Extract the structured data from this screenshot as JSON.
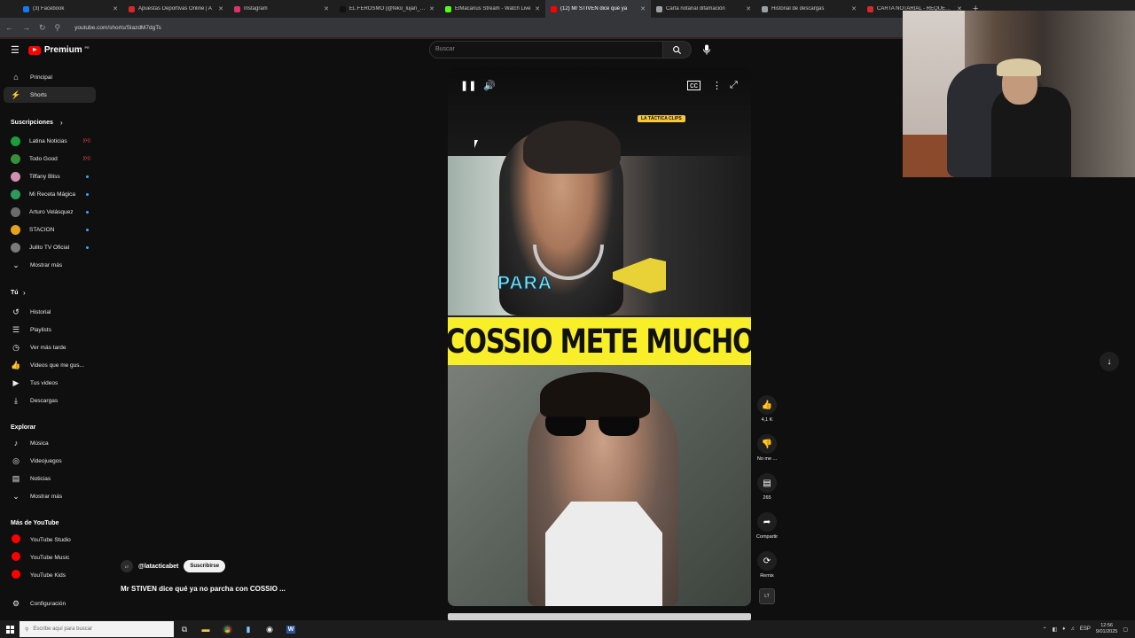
{
  "browser": {
    "tabs": [
      {
        "label": "(3) Facebook",
        "color": "#1877f2",
        "active": false
      },
      {
        "label": "Apuestas Deportivas Online | A",
        "color": "#d62828",
        "active": false
      },
      {
        "label": "Instagram",
        "color": "#e1306c",
        "active": false
      },
      {
        "label": "EL FEROSMO (@feko_lujan_cari",
        "color": "#111111",
        "active": false
      },
      {
        "label": "ElMacarius Stream - Watch Live",
        "color": "#53fc18",
        "active": false
      },
      {
        "label": "(12) Mr STIVEN dice qué ya",
        "color": "#ff0000",
        "active": true
      },
      {
        "label": "Carta notarial difamación",
        "color": "#9aa0a6",
        "active": false
      },
      {
        "label": "Historial de descargas",
        "color": "#9aa0a6",
        "active": false
      },
      {
        "label": "CARTA NOTARIAL - REQUERIM",
        "color": "#d62828",
        "active": false
      }
    ],
    "new_tab": "+",
    "url": "youtube.com/shorts/SlazdM7dgTs"
  },
  "brand": {
    "name": "Premium",
    "region": "PE"
  },
  "sidebar": {
    "main": [
      {
        "label": "Principal",
        "icon": "home-icon",
        "glyph": "⌂"
      },
      {
        "label": "Shorts",
        "icon": "shorts-icon",
        "glyph": "⚡"
      }
    ],
    "subscriptions_title": "Suscripciones",
    "subscriptions": [
      {
        "label": "Latina Noticias",
        "color": "#1a9e3e",
        "indicator": "live"
      },
      {
        "label": "Todo Good",
        "color": "#3a8d3a",
        "indicator": "live"
      },
      {
        "label": "Tiffany Bliss",
        "color": "#d38fb0",
        "indicator": "dot"
      },
      {
        "label": "Mi Receta Mágica",
        "color": "#2e9a5a",
        "indicator": "dot"
      },
      {
        "label": "Arturo Velásquez",
        "color": "#6b6b6b",
        "indicator": "dot"
      },
      {
        "label": "STACION",
        "color": "#e6a21a",
        "indicator": "dot"
      },
      {
        "label": "Julito TV Oficial",
        "color": "#7a7a7a",
        "indicator": "dot"
      }
    ],
    "show_more": "Mostrar más",
    "you_title": "Tú",
    "you": [
      {
        "label": "Historial",
        "icon": "history-icon",
        "glyph": "↺"
      },
      {
        "label": "Playlists",
        "icon": "playlists-icon",
        "glyph": "☰"
      },
      {
        "label": "Ver más tarde",
        "icon": "watch-later-icon",
        "glyph": "◷"
      },
      {
        "label": "Videos que me gus...",
        "icon": "liked-videos-icon",
        "glyph": "👍"
      },
      {
        "label": "Tus videos",
        "icon": "your-videos-icon",
        "glyph": "▶"
      },
      {
        "label": "Descargas",
        "icon": "downloads-icon",
        "glyph": "⤓"
      }
    ],
    "explore_title": "Explorar",
    "explore": [
      {
        "label": "Música",
        "icon": "music-icon",
        "glyph": "♪"
      },
      {
        "label": "Videojuegos",
        "icon": "gaming-icon",
        "glyph": "◎"
      },
      {
        "label": "Noticias",
        "icon": "news-icon",
        "glyph": "▤"
      },
      {
        "label": "Mostrar más",
        "icon": "chevron-down-icon",
        "glyph": "⌄"
      }
    ],
    "more_title": "Más de YouTube",
    "more": [
      {
        "label": "YouTube Studio",
        "color": "#ff0000"
      },
      {
        "label": "YouTube Music",
        "color": "#ff0000"
      },
      {
        "label": "YouTube Kids",
        "color": "#ff0000"
      }
    ],
    "settings": "Configuración"
  },
  "search": {
    "placeholder": "Buscar"
  },
  "video": {
    "tag": "LA TÁCTICA CLIPS",
    "caption_small": "PARA",
    "headline": "COSSIO METE MUCHO"
  },
  "actions": [
    {
      "icon": "like-icon",
      "glyph": "👍",
      "label": "4,1 K"
    },
    {
      "icon": "dislike-icon",
      "glyph": "👎",
      "label": "No me ..."
    },
    {
      "icon": "comments-icon",
      "glyph": "▤",
      "label": "265"
    },
    {
      "icon": "share-icon",
      "glyph": "➦",
      "label": "Compartir"
    },
    {
      "icon": "remix-icon",
      "glyph": "⟳",
      "label": "Remix"
    }
  ],
  "channel": {
    "handle": "@latacticabet",
    "avatar_text": "LT",
    "subscribe": "Suscribirse"
  },
  "title": "Mr STIVEN dice qué ya no parcha con COSSIO ...",
  "taskbar": {
    "search_placeholder": "Escribe aquí para buscar",
    "lang": "ESP",
    "time": "12:56",
    "date": "9/01/2025"
  }
}
